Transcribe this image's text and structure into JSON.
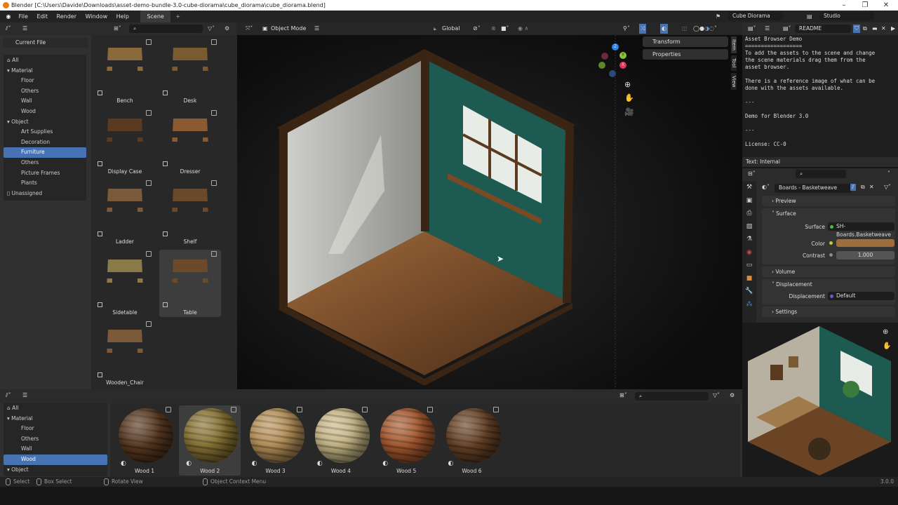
{
  "window": {
    "title": "Blender [C:\\Users\\Davide\\Downloads\\asset-demo-bundle-3.0-cube-diorama\\cube_diorama\\cube_diorama.blend]",
    "minimize": "–",
    "maximize": "❐",
    "close": "✕"
  },
  "menu": {
    "items": [
      "File",
      "Edit",
      "Render",
      "Window",
      "Help"
    ],
    "workspace_tab": "Scene",
    "add_tab": "+",
    "scene": "Cube Diorama",
    "view_layer": "Studio"
  },
  "asset_browser_top": {
    "library": "Current File",
    "tree": [
      {
        "label": "All",
        "level": 0,
        "icon": "home-icon"
      },
      {
        "label": "Material",
        "level": 0,
        "icon": "triangle-down"
      },
      {
        "label": "Floor",
        "level": 1
      },
      {
        "label": "Others",
        "level": 1
      },
      {
        "label": "Wall",
        "level": 1
      },
      {
        "label": "Wood",
        "level": 1
      },
      {
        "label": "Object",
        "level": 0,
        "icon": "triangle-down"
      },
      {
        "label": "Art Supplies",
        "level": 1
      },
      {
        "label": "Decoration",
        "level": 1
      },
      {
        "label": "Furniture",
        "level": 1,
        "selected": true
      },
      {
        "label": "Others",
        "level": 1
      },
      {
        "label": "Picture Frames",
        "level": 1
      },
      {
        "label": "Plants",
        "level": 1
      },
      {
        "label": "Unassigned",
        "level": 0,
        "icon": "file-icon"
      }
    ],
    "assets": [
      {
        "label": "Bench"
      },
      {
        "label": "Desk"
      },
      {
        "label": "Display Case"
      },
      {
        "label": "Dresser"
      },
      {
        "label": "Ladder"
      },
      {
        "label": "Shelf"
      },
      {
        "label": "Sidetable"
      },
      {
        "label": "Table",
        "selected": true
      },
      {
        "label": "Wooden_Chair"
      }
    ]
  },
  "viewport": {
    "mode": "Object Mode",
    "orientation": "Global",
    "sidebar_panels": [
      "Transform",
      "Properties"
    ],
    "sidebar_tabs": [
      "Item",
      "Tool",
      "View"
    ],
    "gizmo": {
      "x": "X",
      "y": "Y",
      "z": "Z"
    }
  },
  "text_editor": {
    "file": "README",
    "lines": [
      "Asset Browser Demo",
      "==================",
      "To add the assets to the scene and change",
      "the scene materials drag them from the",
      "asset browser.",
      "",
      "There is a reference image of what can be",
      "done with the assets available.",
      "",
      "---",
      "",
      "Demo for Blender 3.0",
      "",
      "---",
      "",
      "License: CC-0"
    ],
    "footer": "Text: Internal"
  },
  "properties": {
    "material": "Boards - Basketweave",
    "sections": {
      "preview": "Preview",
      "surface": "Surface",
      "volume": "Volume",
      "displacement": "Displacement",
      "settings": "Settings"
    },
    "surface_label": "Surface",
    "surface_value": "SH-Boards.Basketweave",
    "color_label": "Color",
    "color_value": "#a06e3c",
    "contrast_label": "Contrast",
    "contrast_value": "1.000",
    "displacement_label": "Displacement",
    "displacement_value": "Default"
  },
  "asset_browser_bottom": {
    "tree": [
      {
        "label": "All",
        "level": 0
      },
      {
        "label": "Material",
        "level": 0
      },
      {
        "label": "Floor",
        "level": 1
      },
      {
        "label": "Others",
        "level": 1
      },
      {
        "label": "Wall",
        "level": 1
      },
      {
        "label": "Wood",
        "level": 1,
        "selected": true
      },
      {
        "label": "Object",
        "level": 0
      }
    ],
    "materials": [
      {
        "label": "Wood 1",
        "color": "#5a3a22"
      },
      {
        "label": "Wood 2",
        "color": "#8a7434",
        "selected": true
      },
      {
        "label": "Wood 3",
        "color": "#b8925a"
      },
      {
        "label": "Wood 4",
        "color": "#c8b888"
      },
      {
        "label": "Wood 5",
        "color": "#a85a30"
      },
      {
        "label": "Wood 6",
        "color": "#6a4428"
      }
    ]
  },
  "statusbar": {
    "select": "Select",
    "box_select": "Box Select",
    "rotate": "Rotate View",
    "context": "Object Context Menu",
    "version": "3.0.0"
  }
}
